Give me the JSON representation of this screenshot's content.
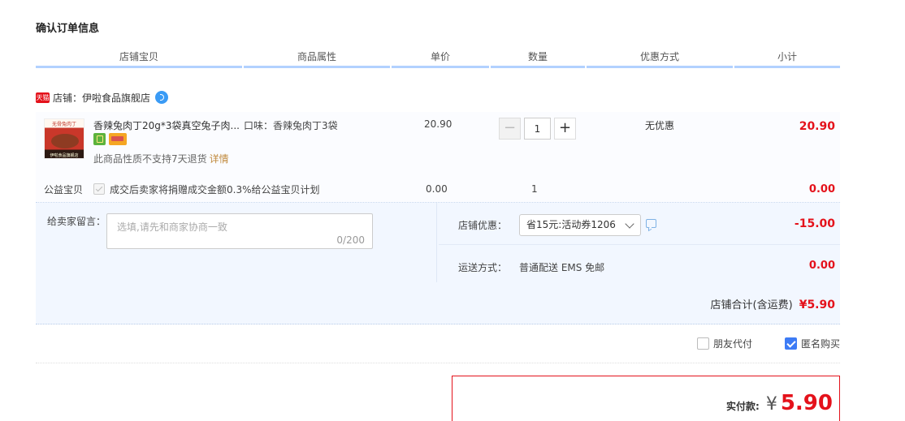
{
  "page_title": "确认订单信息",
  "columns": [
    {
      "label": "店铺宝贝"
    },
    {
      "label": "商品属性"
    },
    {
      "label": "单价"
    },
    {
      "label": "数量"
    },
    {
      "label": "优惠方式"
    },
    {
      "label": "小计"
    }
  ],
  "shop": {
    "badge": "天猫",
    "name": "店铺：伊啦食品旗舰店"
  },
  "item": {
    "thumb_top": "无骨兔肉丁",
    "thumb_bottom": "伊啦食品旗舰店",
    "title": "香辣兔肉丁20g*3袋真空兔子肉...",
    "attribute": "口味：香辣兔肉丁3袋",
    "price": "20.90",
    "quantity": "1",
    "promo": "无优惠",
    "subtotal": "20.90",
    "notice": "此商品性质不支持7天退货",
    "detail_link": "详情"
  },
  "charity": {
    "label": "公益宝贝",
    "text": "成交后卖家将捐赠成交金额0.3%给公益宝贝计划",
    "price": "0.00",
    "quantity": "1",
    "subtotal": "0.00"
  },
  "message": {
    "label": "给卖家留言：",
    "placeholder": "选填,请先和商家协商一致",
    "count": "0/200"
  },
  "shop_promo": {
    "label": "店铺优惠：",
    "selected": "省15元:活动券1206",
    "amount": "-15.00"
  },
  "shipping": {
    "label": "运送方式：",
    "value": "普通配送 EMS 免邮",
    "amount": "0.00"
  },
  "shop_total": {
    "label": "店铺合计(含运费)",
    "amount": "¥5.90"
  },
  "options": {
    "friend_pay": "朋友代付",
    "anonymous": "匿名购买"
  },
  "payment": {
    "label": "实付款:",
    "currency": "¥",
    "amount": "5.90"
  }
}
